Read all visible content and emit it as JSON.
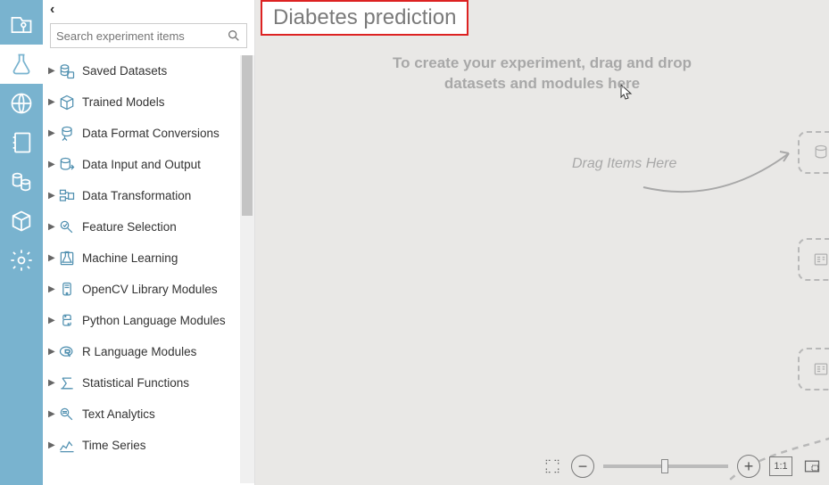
{
  "rail": {
    "items": [
      "projects",
      "experiments",
      "web",
      "notebook",
      "storage",
      "cube",
      "settings"
    ]
  },
  "sidebar": {
    "search_placeholder": "Search experiment items",
    "items": [
      {
        "label": "Saved Datasets"
      },
      {
        "label": "Trained Models"
      },
      {
        "label": "Data Format Conversions"
      },
      {
        "label": "Data Input and Output"
      },
      {
        "label": "Data Transformation"
      },
      {
        "label": "Feature Selection"
      },
      {
        "label": "Machine Learning"
      },
      {
        "label": "OpenCV Library Modules"
      },
      {
        "label": "Python Language Modules"
      },
      {
        "label": "R Language Modules"
      },
      {
        "label": "Statistical Functions"
      },
      {
        "label": "Text Analytics"
      },
      {
        "label": "Time Series"
      }
    ]
  },
  "canvas": {
    "title": "Diabetes prediction",
    "hint_l1": "To create your experiment, drag and drop",
    "hint_l2": "datasets and modules here",
    "drag_hint": "Drag Items Here",
    "zoom_ratio": "1:1"
  }
}
